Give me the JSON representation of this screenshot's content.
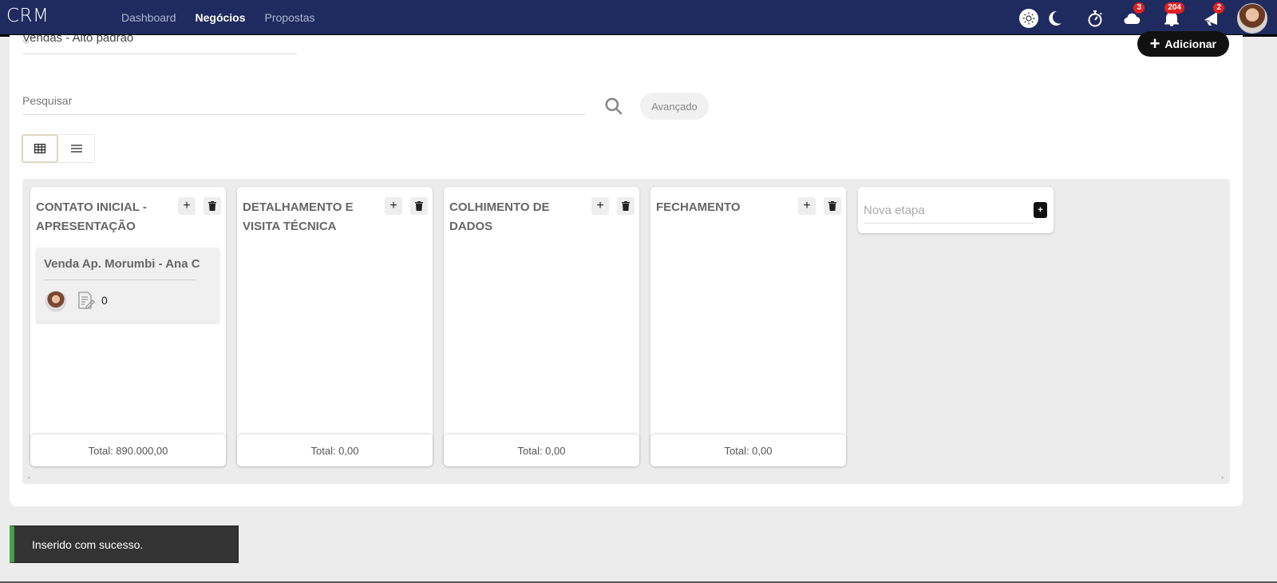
{
  "app": {
    "brand": "CRM"
  },
  "nav": [
    {
      "label": "Dashboard",
      "active": false
    },
    {
      "label": "Negócios",
      "active": true
    },
    {
      "label": "Propostas",
      "active": false
    }
  ],
  "topbar": {
    "icons": [
      {
        "name": "sun-icon"
      },
      {
        "name": "moon-icon"
      },
      {
        "name": "stopwatch-icon"
      },
      {
        "name": "cloud-icon",
        "badge": "3"
      },
      {
        "name": "bell-icon",
        "badge": "204"
      },
      {
        "name": "megaphone-icon",
        "badge": "2"
      }
    ],
    "badge_color": "#e02020"
  },
  "pipeline": {
    "selected": "Vendas - Alto padrão"
  },
  "toolbar": {
    "add_label": "Adicionar"
  },
  "search": {
    "placeholder": "Pesquisar",
    "value": "",
    "advanced_label": "Avançado"
  },
  "board": {
    "columns": [
      {
        "title": "CONTATO INICIAL - APRESENTAÇÃO",
        "total": "Total: 890.000,00",
        "deals": [
          {
            "title": "Venda Ap. Morumbi - Ana C",
            "count": "0"
          }
        ]
      },
      {
        "title": "DETALHAMENTO E VISITA TÉCNICA",
        "total": "Total: 0,00",
        "deals": []
      },
      {
        "title": "COLHIMENTO DE DADOS",
        "total": "Total: 0,00",
        "deals": []
      },
      {
        "title": "FECHAMENTO",
        "total": "Total: 0,00",
        "deals": []
      }
    ],
    "new_stage_placeholder": "Nova etapa",
    "new_stage_button": "+"
  },
  "toast": {
    "message": "Inserido com sucesso.",
    "accent": "#43a047"
  },
  "colors": {
    "topbar": "#1f2b5e",
    "primary_button": "#111111"
  }
}
